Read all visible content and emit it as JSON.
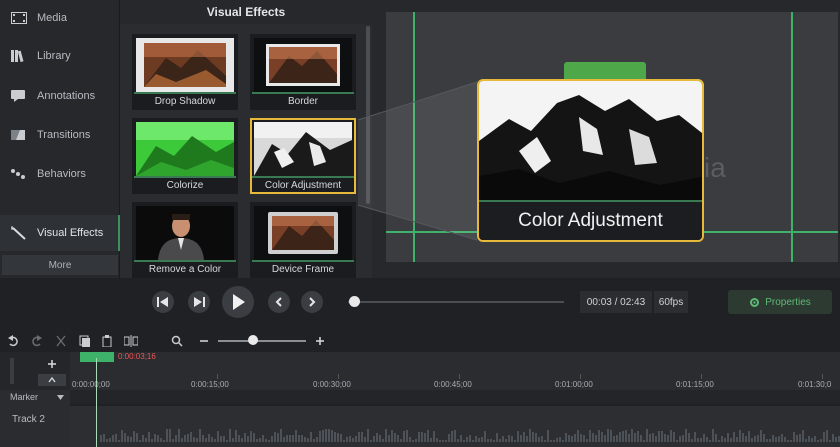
{
  "sidebar": {
    "items": [
      {
        "label": "Media",
        "icon": "film-icon"
      },
      {
        "label": "Library",
        "icon": "library-icon"
      },
      {
        "label": "Annotations",
        "icon": "annotation-icon"
      },
      {
        "label": "Transitions",
        "icon": "transition-icon"
      },
      {
        "label": "Behaviors",
        "icon": "behavior-icon"
      },
      {
        "label": "Visual Effects",
        "icon": "wand-icon"
      }
    ],
    "more_label": "More"
  },
  "effects_panel": {
    "title": "Visual Effects",
    "tiles": [
      {
        "label": "Drop Shadow"
      },
      {
        "label": "Border"
      },
      {
        "label": "Colorize"
      },
      {
        "label": "Color Adjustment"
      },
      {
        "label": "Remove a Color"
      },
      {
        "label": "Device Frame"
      }
    ]
  },
  "preview": {
    "callout_title": "Color Adjustment",
    "watermark_text": "ia"
  },
  "transport": {
    "time": "00:03 / 02:43",
    "fps": "60fps",
    "properties_label": "Properties",
    "scrub_progress": 0.02
  },
  "timeline": {
    "playhead_time": "0:00:03;16",
    "ruler_labels": [
      "0:00:00;00",
      "0:00:15;00",
      "0:00:30;00",
      "0:00:45;00",
      "0:01:00;00",
      "0:01:15;00",
      "0:01:30;0"
    ],
    "marker_label": "Marker",
    "track_label": "Track 2",
    "zoom_level": 0.35
  },
  "colors": {
    "accent_green": "#3fb26a",
    "selection_gold": "#e6b93a",
    "playhead_red": "#e55555"
  }
}
